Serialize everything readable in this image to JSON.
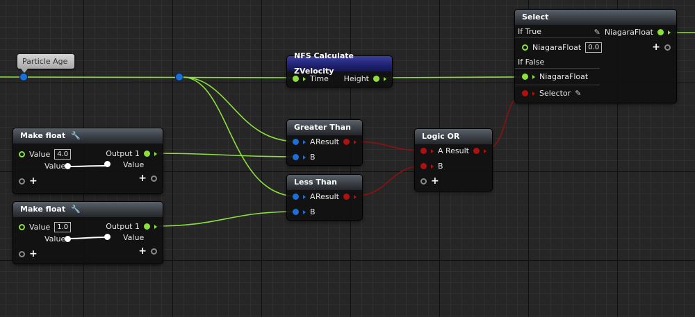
{
  "particle_age": {
    "label": "Particle Age"
  },
  "calc_node": {
    "title": "NFS Calculate ZVelocity",
    "input": "Time",
    "output": "Height"
  },
  "greater_node": {
    "title": "Greater Than",
    "a": "A",
    "b": "B",
    "result": "Result"
  },
  "less_node": {
    "title": "Less Than",
    "a": "A",
    "b": "B",
    "result": "Result"
  },
  "logic_or_node": {
    "title": "Logic OR",
    "a": "A",
    "b": "B",
    "result": "Result"
  },
  "make_float_1": {
    "title": "Make float",
    "value_label": "Value",
    "value": "4.0",
    "slider_label": "Value",
    "output": "Output 1",
    "output_sub": "Value"
  },
  "make_float_2": {
    "title": "Make float",
    "value_label": "Value",
    "value": "1.0",
    "slider_label": "Value",
    "output": "Output 1",
    "output_sub": "Value"
  },
  "select_node": {
    "title": "Select",
    "if_true": "If True",
    "true_type": "NiagaraFloat",
    "true_value": "0.0",
    "if_false": "If False",
    "false_type": "NiagaraFloat",
    "selector": "Selector",
    "output": "NiagaraFloat"
  },
  "colors": {
    "float_pin": "#8de03b",
    "vector_pin": "#1b6fd8",
    "bool_pin": "#b01010"
  }
}
